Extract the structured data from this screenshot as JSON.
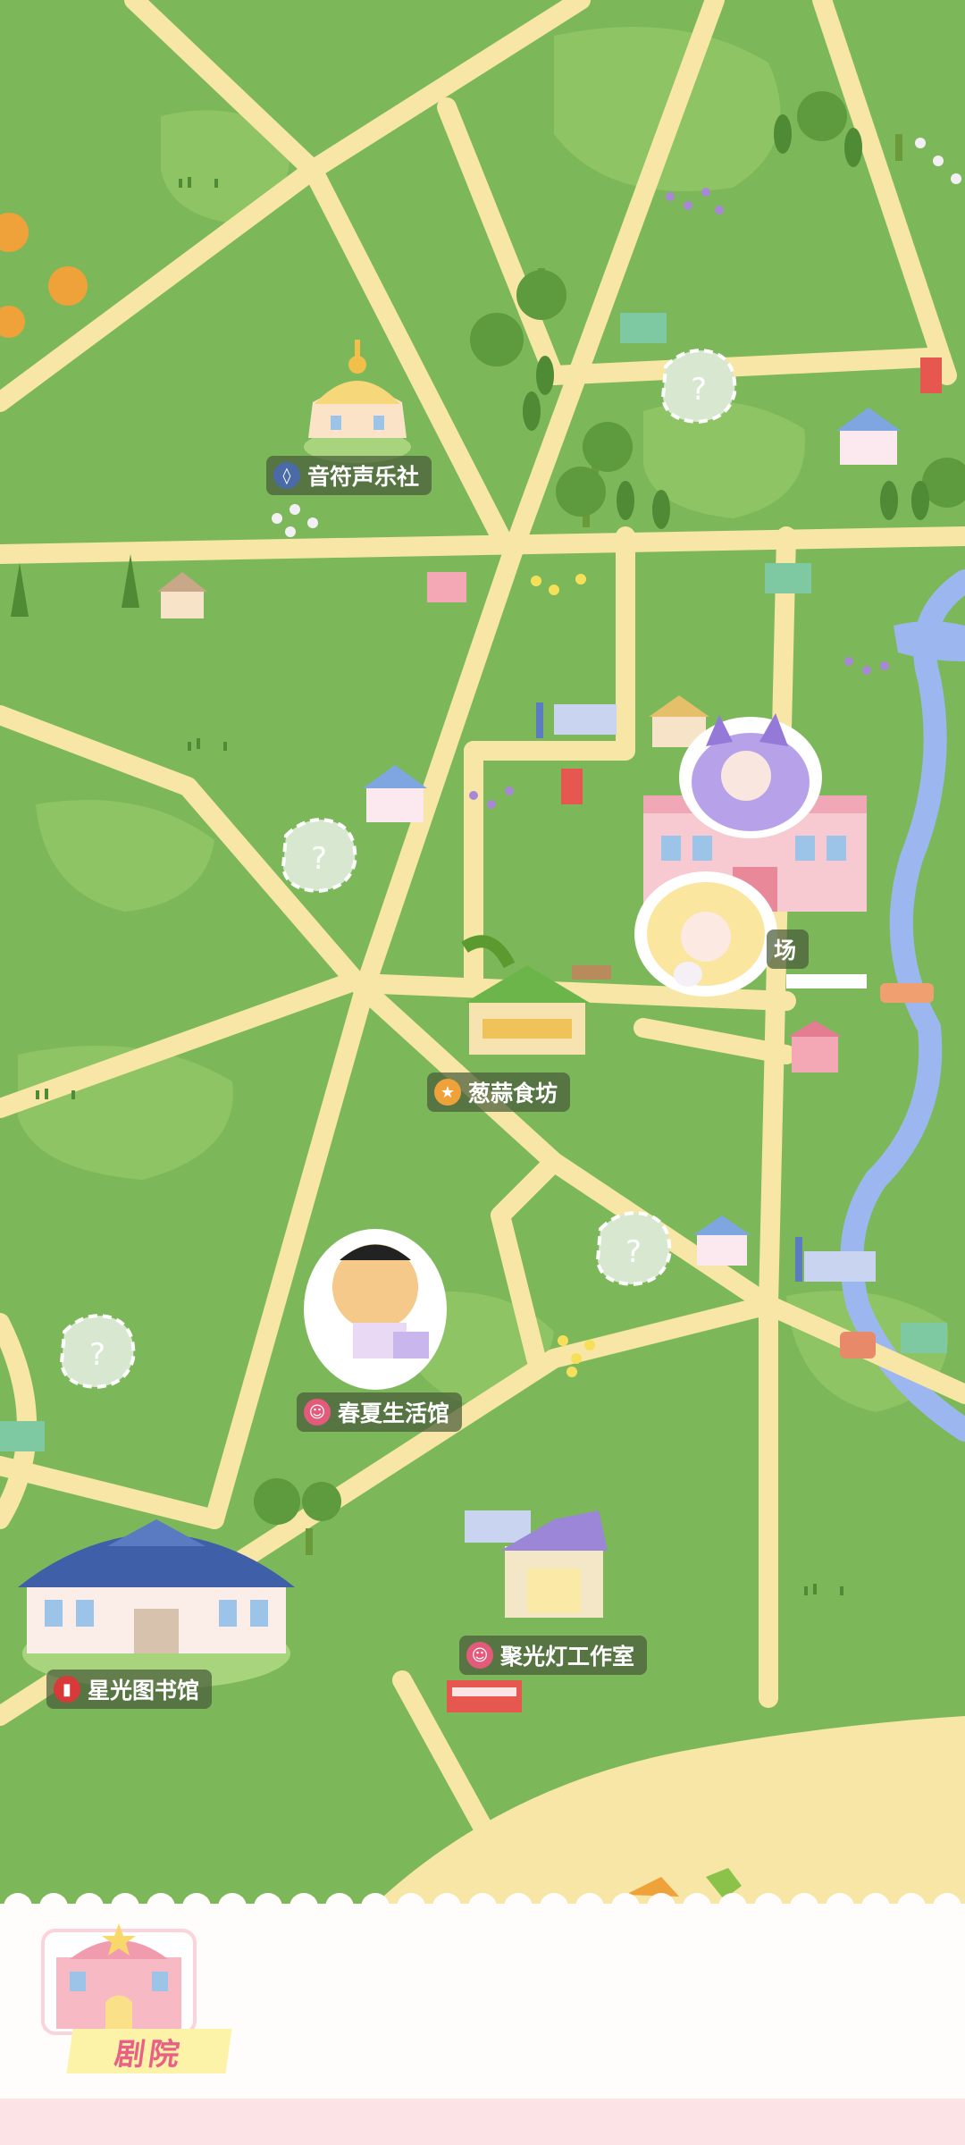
{
  "map": {
    "locations": [
      {
        "id": "music",
        "name": "音符声乐社",
        "icon": "graduation-cap-icon",
        "icon_color": "#4a6aa8"
      },
      {
        "id": "food",
        "name": "葱蒜食坊",
        "icon": "fork-spoon-icon",
        "icon_color": "#f0a23a"
      },
      {
        "id": "spring",
        "name": "春夏生活馆",
        "icon": "masks-icon",
        "icon_color": "#e35a7a"
      },
      {
        "id": "library",
        "name": "星光图书馆",
        "icon": "book-icon",
        "icon_color": "#d83a3a"
      },
      {
        "id": "spotlight",
        "name": "聚光灯工作室",
        "icon": "masks-icon",
        "icon_color": "#e35a7a"
      },
      {
        "id": "plaza",
        "name": "场",
        "icon": "none",
        "icon_color": "#e35a7a"
      }
    ],
    "unknown_marker": "?"
  },
  "bottom_panel": {
    "selected_building": "剧院"
  },
  "colors": {
    "grass": "#7cb85a",
    "grass_light": "#9ccc6c",
    "road": "#f7e6a6",
    "river": "#9cb7ef",
    "label_bg": "#4a5c3a",
    "accent_pink": "#ea5f86"
  }
}
